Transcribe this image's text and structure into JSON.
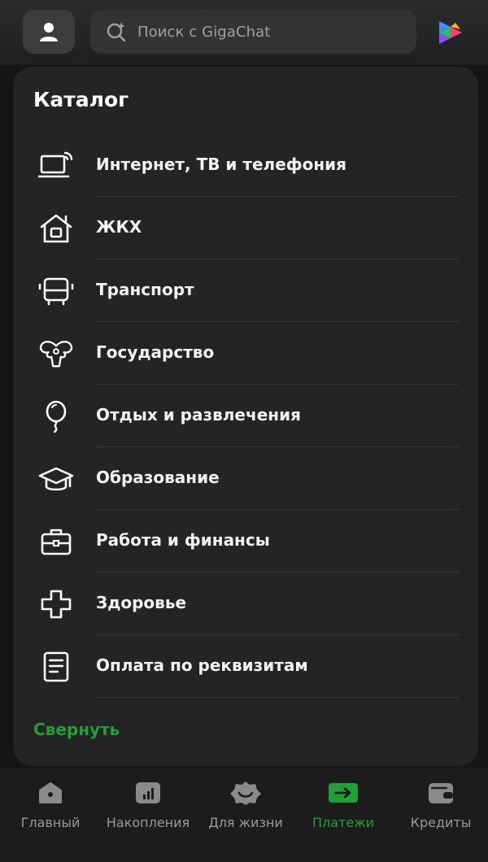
{
  "header": {
    "search_placeholder": "Поиск с GigaChat"
  },
  "catalog": {
    "title": "Каталог",
    "items": [
      {
        "label": "Интернет, ТВ и телефония",
        "icon": "laptop-wifi-icon"
      },
      {
        "label": "ЖКХ",
        "icon": "house-icon"
      },
      {
        "label": "Транспорт",
        "icon": "bus-icon"
      },
      {
        "label": "Государство",
        "icon": "emblem-icon"
      },
      {
        "label": "Отдых и развлечения",
        "icon": "balloon-icon"
      },
      {
        "label": "Образование",
        "icon": "graduation-cap-icon"
      },
      {
        "label": "Работа и финансы",
        "icon": "briefcase-icon"
      },
      {
        "label": "Здоровье",
        "icon": "medical-cross-icon"
      },
      {
        "label": "Оплата по реквизитам",
        "icon": "document-icon"
      }
    ],
    "collapse_label": "Свернуть"
  },
  "tabbar": {
    "tabs": [
      {
        "label": "Главный",
        "icon": "home-icon",
        "active": false
      },
      {
        "label": "Накопления",
        "icon": "savings-chart-icon",
        "active": false
      },
      {
        "label": "Для жизни",
        "icon": "smile-icon",
        "active": false
      },
      {
        "label": "Платежи",
        "icon": "payments-arrow-icon",
        "active": true
      },
      {
        "label": "Кредиты",
        "icon": "wallet-icon",
        "active": false
      }
    ]
  },
  "colors": {
    "accent": "#21a038",
    "background": "#151515",
    "card": "#242424",
    "text": "#ffffff",
    "muted": "#9a9a9a"
  }
}
